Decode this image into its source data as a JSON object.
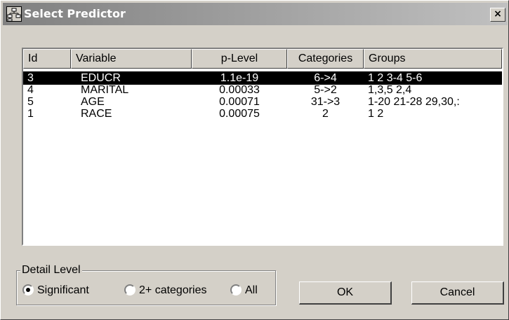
{
  "window": {
    "title": "Select Predictor",
    "close_glyph": "×"
  },
  "icons": {
    "app": "tree-icon",
    "close": "close-icon"
  },
  "list": {
    "columns": [
      "Id",
      "Variable",
      "p-Level",
      "Categories",
      "Groups"
    ],
    "rows": [
      {
        "id": "3",
        "variable": "EDUCR",
        "p_level": "1.1e-19",
        "categories": "6->4",
        "groups": "1 2 3-4 5-6",
        "selected": true
      },
      {
        "id": "4",
        "variable": "MARITAL",
        "p_level": "0.00033",
        "categories": "5->2",
        "groups": "1,3,5 2,4",
        "selected": false
      },
      {
        "id": "5",
        "variable": "AGE",
        "p_level": "0.00071",
        "categories": "31->3",
        "groups": "1-20 21-28 29,30,:",
        "selected": false
      },
      {
        "id": "1",
        "variable": "RACE",
        "p_level": "0.00075",
        "categories": "2",
        "groups": "1 2",
        "selected": false
      }
    ]
  },
  "detail_level": {
    "label": "Detail Level",
    "options": [
      "Significant",
      "2+ categories",
      "All"
    ],
    "selected": "Significant"
  },
  "buttons": {
    "ok": "OK",
    "cancel": "Cancel"
  },
  "colors": {
    "selection_bg": "#000000",
    "selection_fg": "#ffffff",
    "face": "#d4d0c8"
  }
}
